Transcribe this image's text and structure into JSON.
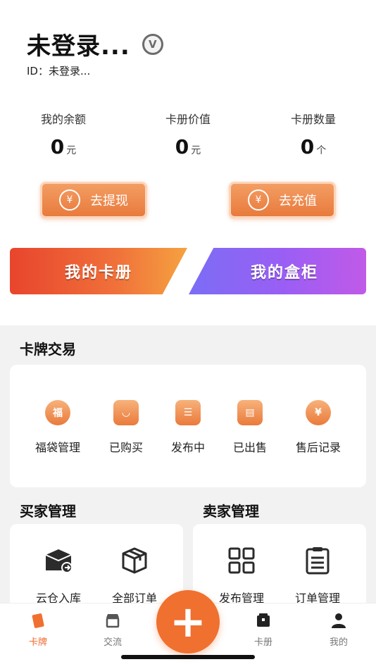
{
  "profile": {
    "name": "未登录...",
    "badge": "V",
    "id_text": "ID：未登录..."
  },
  "stats": [
    {
      "label": "我的余额",
      "value": "0",
      "unit": "元"
    },
    {
      "label": "卡册价值",
      "value": "0",
      "unit": "元"
    },
    {
      "label": "卡册数量",
      "value": "0",
      "unit": "个"
    }
  ],
  "actions": {
    "withdraw": "去提现",
    "recharge": "去充值",
    "currency_icon": "¥"
  },
  "big_buttons": {
    "my_albums": "我的卡册",
    "my_boxes": "我的盒柜"
  },
  "card_trade": {
    "title": "卡牌交易",
    "items": [
      {
        "label": "福袋管理",
        "icon": "lucky-bag-icon",
        "glyph": "福"
      },
      {
        "label": "已购买",
        "icon": "shopping-bag-icon",
        "glyph": "◡"
      },
      {
        "label": "发布中",
        "icon": "publishing-doc-icon",
        "glyph": "☰"
      },
      {
        "label": "已出售",
        "icon": "sold-doc-icon",
        "glyph": "▤"
      },
      {
        "label": "售后记录",
        "icon": "after-sales-icon",
        "glyph": "¥"
      }
    ]
  },
  "buyer": {
    "title": "买家管理",
    "items": [
      {
        "label": "云仓入库",
        "icon": "warehouse-icon"
      },
      {
        "label": "全部订单",
        "icon": "box-icon"
      }
    ]
  },
  "seller": {
    "title": "卖家管理",
    "items": [
      {
        "label": "发布管理",
        "icon": "grid-icon"
      },
      {
        "label": "订单管理",
        "icon": "clipboard-icon"
      }
    ]
  },
  "tabs": [
    {
      "label": "卡牌",
      "icon": "card-icon",
      "active": true
    },
    {
      "label": "交流",
      "icon": "shop-icon",
      "active": false
    },
    {
      "label": "卡册",
      "icon": "album-icon",
      "active": false
    },
    {
      "label": "我的",
      "icon": "user-icon",
      "active": false
    }
  ],
  "fab": "+",
  "colors": {
    "accent": "#f0702f",
    "orange_gradient_start": "#e8452d",
    "purple_gradient_start": "#7b6df5",
    "background_gray": "#f2f2f2"
  }
}
